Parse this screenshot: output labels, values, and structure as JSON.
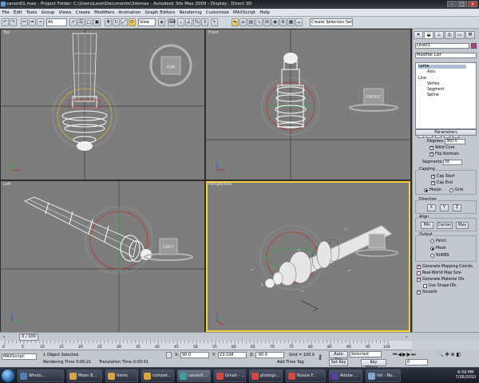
{
  "window": {
    "title": "canon01.max   - Project Folder: C:\\Users\\Love\\Documents\\3dsmax    - Autodesk 3ds Max  2009          - Display : Direct 3D",
    "controls": [
      "–",
      "□",
      "×"
    ]
  },
  "menu": [
    "File",
    "Edit",
    "Tools",
    "Group",
    "Views",
    "Create",
    "Modifiers",
    "Animation",
    "Graph Editors",
    "Rendering",
    "Customize",
    "MAXScript",
    "Help"
  ],
  "toolbar": {
    "filter": "All",
    "ref_coord": "View",
    "selection_set": "Create Selection Set"
  },
  "viewports": [
    {
      "label": "Top",
      "cube_label": "TOP"
    },
    {
      "label": "Front",
      "cube_label": "FRONT"
    },
    {
      "label": "Left",
      "cube_label": "LEFT"
    },
    {
      "label": "Perspective",
      "cube_label": ""
    }
  ],
  "command_panel": {
    "tabs": [
      "create",
      "modify",
      "hierarchy",
      "motion",
      "display",
      "utilities"
    ],
    "object_name": "Line01",
    "object_color": "#cc2fa0",
    "modifier_list": "Modifier List",
    "stack": [
      "Lathe",
      "Axis",
      "Line",
      "Vertex",
      "Segment",
      "Spline"
    ],
    "parameters": {
      "title": "Parameters",
      "degrees_label": "Degrees:",
      "degrees": "360.0",
      "weld_core": "Weld Core",
      "flip_normals": "Flip Normals",
      "segments_label": "Segments:",
      "segments": "16",
      "capping": "Capping",
      "cap_start": "Cap Start",
      "cap_end": "Cap End",
      "morph": "Morph",
      "grid": "Grid",
      "direction": "Direction",
      "dir_x": "X",
      "dir_y": "Y",
      "dir_z": "Z",
      "align": "Align",
      "align_min": "Min",
      "align_center": "Center",
      "align_max": "Max",
      "output": "Output",
      "patch": "Patch",
      "mesh": "Mesh",
      "nurbs": "NURBS",
      "gen_mapping": "Generate Mapping Coords.",
      "real_world": "Real-World Map Size",
      "gen_material": "Generate Material IDs",
      "use_shape": "Use Shape IDs",
      "smooth": "Smooth"
    }
  },
  "timeline": {
    "frame": "0 / 100",
    "ticks": [
      "0",
      "5",
      "10",
      "15",
      "20",
      "25",
      "30",
      "35",
      "40",
      "45",
      "50",
      "55",
      "60",
      "65",
      "70",
      "75",
      "80",
      "85",
      "90",
      "95",
      "100"
    ]
  },
  "status": {
    "maxscript": "MAXScript.",
    "selected": "1 Object Selected",
    "render_time": "Rendering Time  0:00:21",
    "translation_time": "Translation Time  0:00:01",
    "x_label": "X:",
    "x": "90.0",
    "y_label": "Y:",
    "y": "23.198",
    "z_label": "Z:",
    "z": "-90.0",
    "grid": "Grid = 100.0",
    "add_time_tag": "Add Time Tag",
    "auto_key": "Auto Key",
    "selected_dd": "Selected",
    "set_key": "Set Key",
    "key_filters": "Key Filters...",
    "frame_box": "0"
  },
  "taskbar": {
    "tasks": [
      {
        "label": "Windo...",
        "color": "#4f7fb5"
      },
      {
        "label": "Moon B...",
        "color": "#d9a441"
      },
      {
        "label": "items",
        "color": "#d9a441"
      },
      {
        "label": "compet...",
        "color": "#d9a441"
      },
      {
        "label": "canon0...",
        "color": "#3aa0a0"
      },
      {
        "label": "Gmail - ...",
        "color": "#d8453b"
      },
      {
        "label": "photogr...",
        "color": "#d8453b"
      },
      {
        "label": "Russia F...",
        "color": "#d8453b"
      },
      {
        "label": "Adobe ...",
        "color": "#5d3fa0"
      },
      {
        "label": "list - No...",
        "color": "#7fa6cf"
      }
    ],
    "time": "6:59 PM",
    "date": "7/26/2010"
  }
}
